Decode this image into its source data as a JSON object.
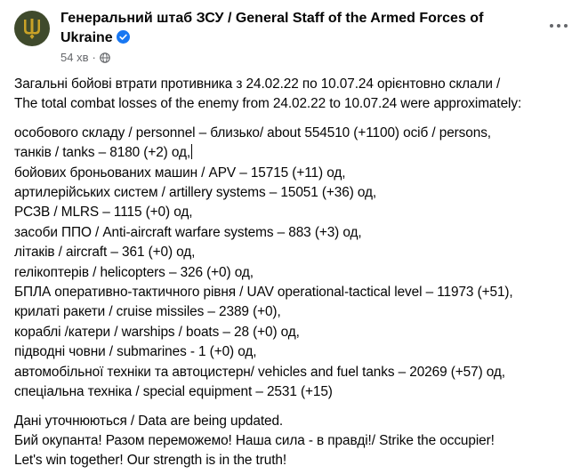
{
  "post": {
    "author": "Генеральний штаб ЗСУ / General Staff of the Armed Forces of Ukraine",
    "time": "54 хв",
    "colors": {
      "accent": "#1877f2",
      "avatar_bg": "#3f4a2c",
      "emblem": "#c9a227"
    },
    "icons": {
      "avatar": "trident-icon",
      "verified": "verified-badge-icon",
      "audience": "globe-icon",
      "menu": "more-options-icon"
    }
  },
  "content": {
    "intro_line1": "Загальні бойові втрати противника з 24.02.22 по 10.07.24 орієнтовно склали /",
    "intro_line2": "The total combat losses of the enemy from 24.02.22 to 10.07.24 were approximately:",
    "losses": [
      "особового складу / personnel – близько/ about 554510 (+1100) осіб / persons,",
      "танків / tanks – 8180 (+2) од,",
      "бойових броньованих машин / APV – 15715 (+11) од,",
      "артилерійських систем / artillery systems –  15051 (+36) од,",
      "РСЗВ / MLRS – 1115 (+0) од,",
      "засоби ППО / Anti-aircraft warfare systems – 883 (+3) од,",
      "літаків / aircraft – 361 (+0) од,",
      "гелікоптерів / helicopters – 326 (+0) од,",
      "БПЛА оперативно-тактичного рівня / UAV operational-tactical level – 11973 (+51),",
      "крилаті ракети / cruise missiles – 2389 (+0),",
      "кораблі /катери / warships / boats – 28 (+0) од,",
      "підводні човни / submarines - 1 (+0) од,",
      "автомобільної техніки та автоцистерн/ vehicles and fuel tanks – 20269 (+57) од,",
      "спеціальна техніка / special equipment – 2531 (+15)"
    ],
    "outro_line1": "Дані уточнюються / Data are being updated.",
    "outro_line2": "Бий окупанта! Разом переможемо! Наша сила - в правді!/ Strike the occupier!",
    "outro_line3": "Let's win together! Our strength is in the truth!"
  }
}
